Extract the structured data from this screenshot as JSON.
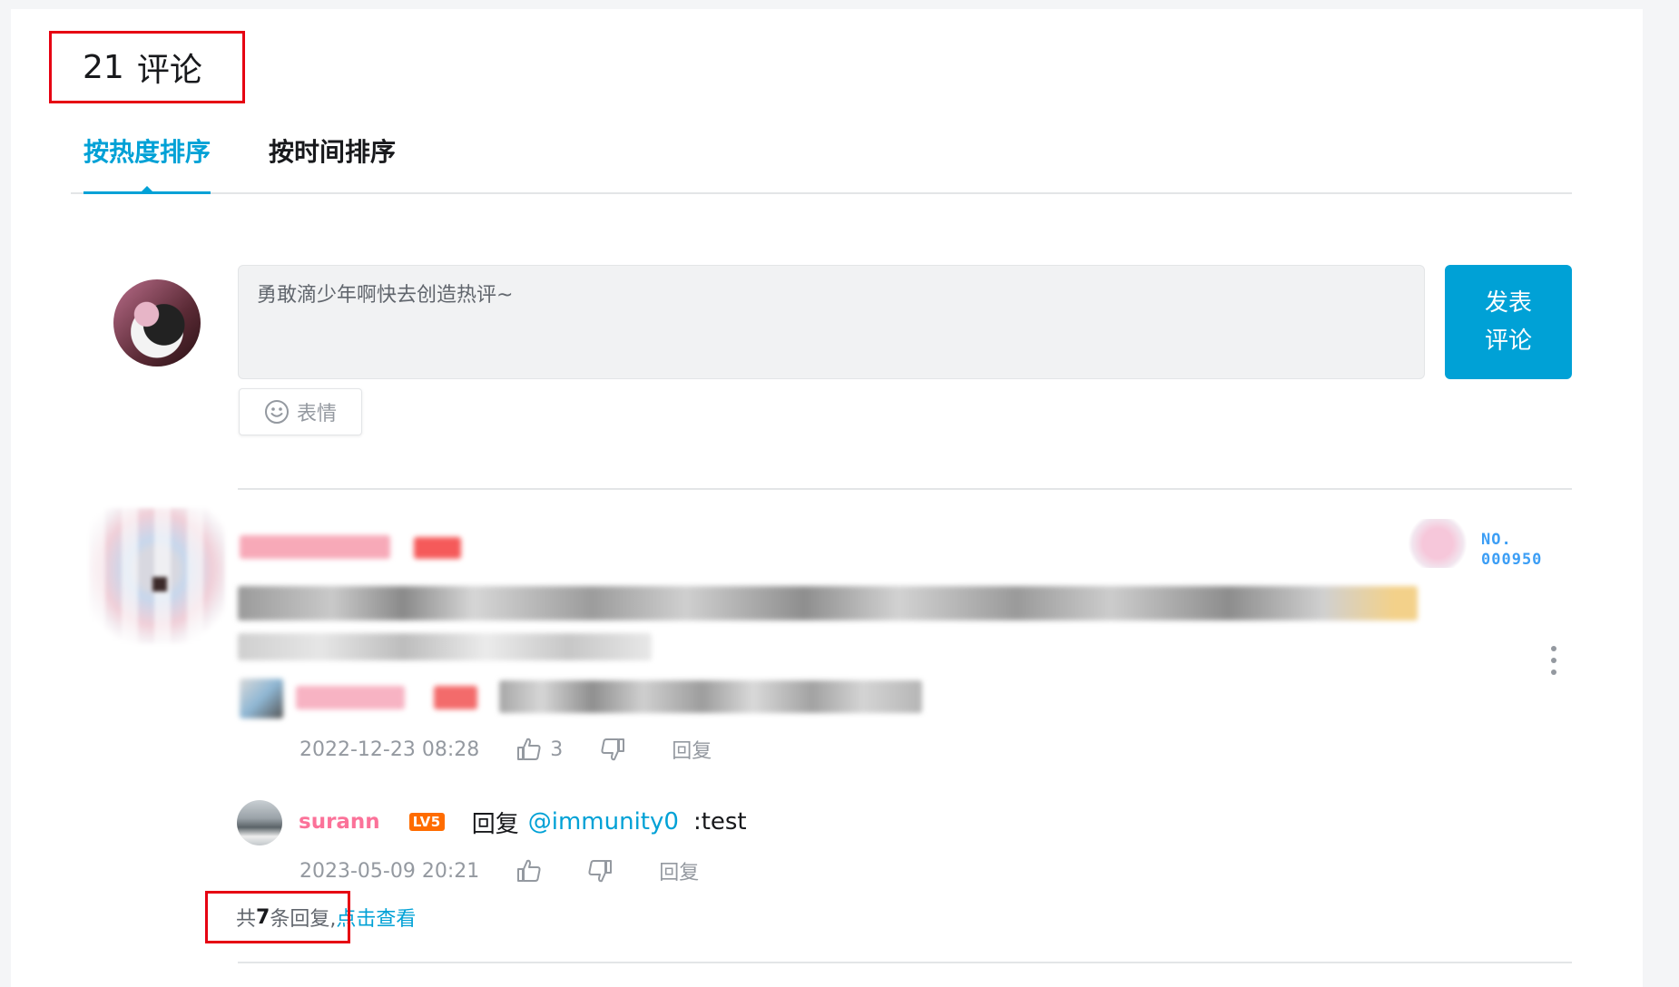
{
  "header": {
    "count": "21",
    "label": "评论"
  },
  "tabs": [
    {
      "label": "按热度排序",
      "active": true
    },
    {
      "label": "按时间排序",
      "active": false
    }
  ],
  "composer": {
    "placeholder": "勇敢滴少年啊快去创造热评~",
    "submit_line1": "发表",
    "submit_line2": "评论",
    "emoji_label": "表情"
  },
  "comment": {
    "blurred": true,
    "badge_line1": "NO.",
    "badge_line2": "000950",
    "time": "2022-12-23 08:28",
    "likes": "3",
    "reply_label": "回复"
  },
  "reply": {
    "user": "surann",
    "level": "LV5",
    "prefix": "回复",
    "mention": "@immunity0",
    "text": ":test",
    "time": "2023-05-09 20:21",
    "reply_label": "回复"
  },
  "summary": {
    "prefix": "共",
    "count": "7",
    "suffix": "条回复,",
    "link": "点击查看"
  },
  "colors": {
    "accent": "#00a1d6",
    "username": "#fb7299",
    "level_badge": "#ff6c00",
    "highlight_box": "#e60012"
  }
}
